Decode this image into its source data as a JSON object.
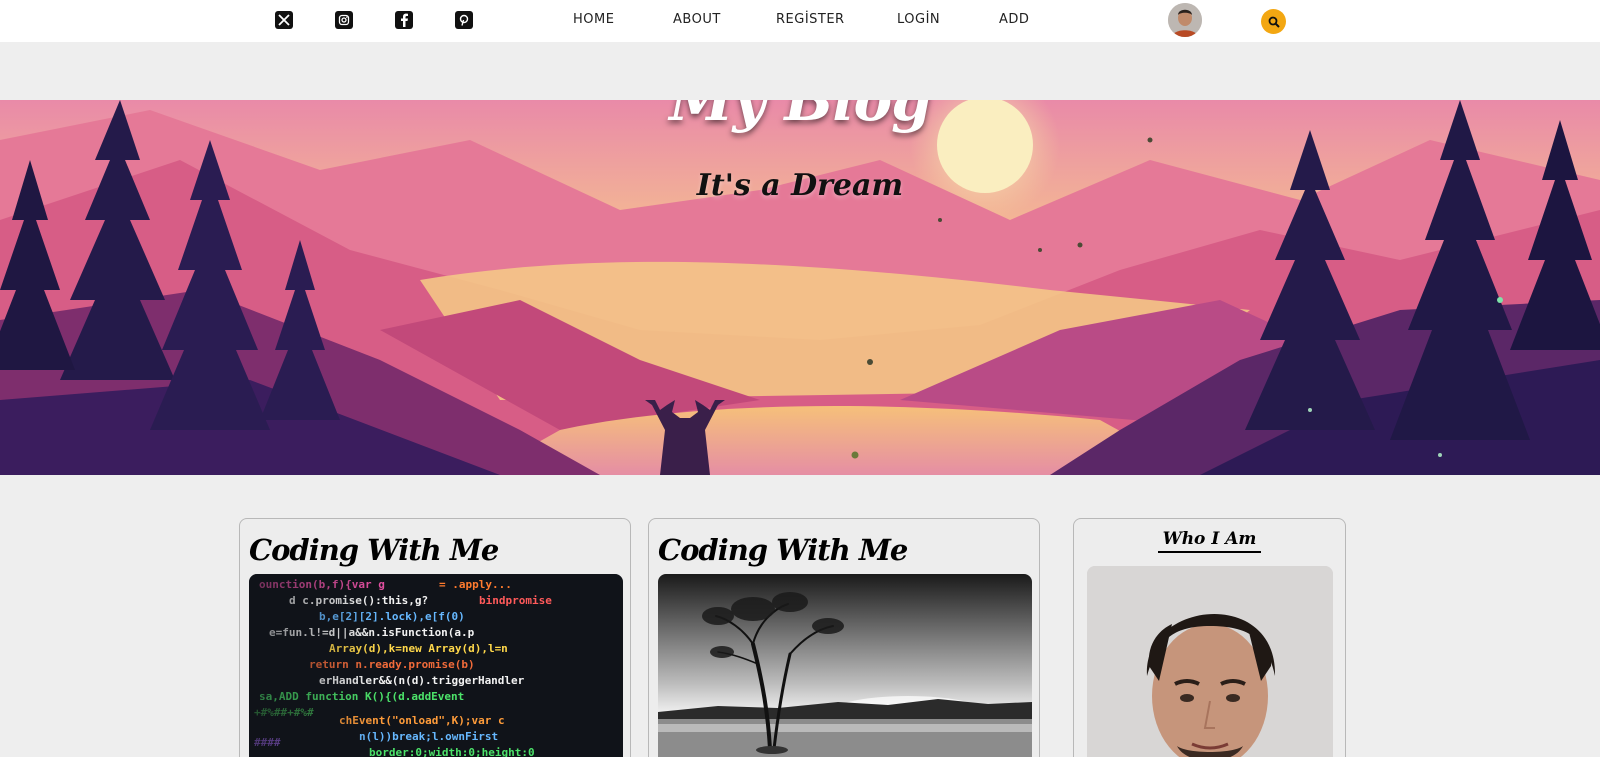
{
  "nav": {
    "social": [
      {
        "icon": "x-twitter-icon"
      },
      {
        "icon": "instagram-icon"
      },
      {
        "icon": "facebook-icon"
      },
      {
        "icon": "pinterest-icon"
      }
    ],
    "links": [
      "HOME",
      "ABOUT",
      "REGİSTER",
      "LOGİN",
      "ADD"
    ],
    "avatar_icon": "avatar",
    "search_icon": "search-icon",
    "accent": "#f3a712"
  },
  "hero": {
    "title": "My Blog",
    "subtitle": "It's a Dream"
  },
  "posts": [
    {
      "title": "Coding With Me"
    },
    {
      "title": "Coding With Me"
    }
  ],
  "sidebar": {
    "title": "Who I Am"
  }
}
